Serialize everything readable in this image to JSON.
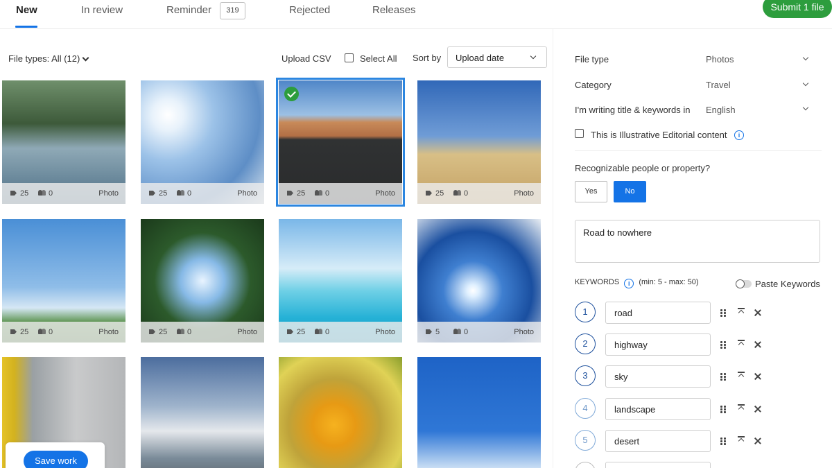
{
  "tabs": [
    {
      "label": "New"
    },
    {
      "label": "In review"
    },
    {
      "label": "Reminder",
      "badge": "319"
    },
    {
      "label": "Rejected"
    },
    {
      "label": "Releases"
    }
  ],
  "submit_label": "Submit 1 file",
  "toolbar": {
    "file_types": "File types: All (12)",
    "upload_csv": "Upload CSV",
    "select_all": "Select All",
    "sort_by": "Sort by",
    "sort_value": "Upload date"
  },
  "tiles": [
    {
      "keywords": "25",
      "people": "0",
      "type": "Photo",
      "subject": "cypress trees by the sea"
    },
    {
      "keywords": "25",
      "people": "0",
      "type": "Photo",
      "subject": "skier jumping against sun"
    },
    {
      "keywords": "25",
      "people": "0",
      "type": "Photo",
      "subject": "empty desert road",
      "selected": true
    },
    {
      "keywords": "25",
      "people": "0",
      "type": "Photo",
      "subject": "golden hills under blue sky"
    },
    {
      "keywords": "25",
      "people": "0",
      "type": "Photo",
      "subject": "glider wing in sky"
    },
    {
      "keywords": "25",
      "people": "0",
      "type": "Photo",
      "subject": "palm trees from below"
    },
    {
      "keywords": "25",
      "people": "0",
      "type": "Photo",
      "subject": "feet floating in pool"
    },
    {
      "keywords": "5",
      "people": "0",
      "type": "Photo",
      "subject": "skier in orange jumping"
    },
    {
      "keywords": "",
      "people": "",
      "type": "",
      "subject": "yellow taxi and building"
    },
    {
      "keywords": "",
      "people": "",
      "type": "",
      "subject": "hiker on rocky peak"
    },
    {
      "keywords": "",
      "people": "",
      "type": "",
      "subject": "yellow fish"
    },
    {
      "keywords": "",
      "people": "",
      "type": "",
      "subject": "skier in orange against blue sky"
    }
  ],
  "save_label": "Save work",
  "panel": {
    "file_type_label": "File type",
    "file_type_value": "Photos",
    "category_label": "Category",
    "category_value": "Travel",
    "language_label": "I'm writing title & keywords in",
    "language_value": "English",
    "editorial_label": "This is Illustrative Editorial content",
    "recognizable_label": "Recognizable people or property?",
    "yes_label": "Yes",
    "no_label": "No",
    "title_value": "Road to nowhere",
    "keywords_label": "KEYWORDS",
    "keywords_limits": "(min: 5 - max: 50)",
    "paste_keywords": "Paste Keywords",
    "keywords": [
      {
        "num": "1",
        "value": "road"
      },
      {
        "num": "2",
        "value": "highway"
      },
      {
        "num": "3",
        "value": "sky"
      },
      {
        "num": "4",
        "value": "landscape"
      },
      {
        "num": "5",
        "value": "desert"
      }
    ]
  },
  "colors": {
    "accent": "#1473e6",
    "submit": "#2d9d3d",
    "selected_outline": "#2c86e0"
  }
}
